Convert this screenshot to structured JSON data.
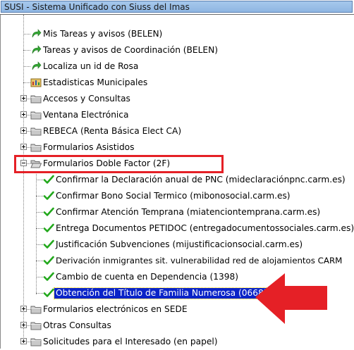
{
  "window": {
    "title": "SUSI - Sistema Unificado con Siuss del Imas"
  },
  "tree": {
    "root_items": [
      {
        "label": "Mis Tareas y avisos (BELEN)",
        "icon": "green-arrow-icon"
      },
      {
        "label": "Tareas y avisos de Coordinación (BELEN)",
        "icon": "green-arrow-icon"
      },
      {
        "label": "Localiza un id de Rosa",
        "icon": "green-arrow-icon"
      },
      {
        "label": "Estadisticas Municipales",
        "icon": "report-icon"
      },
      {
        "label": "Accesos y Consultas",
        "icon": "folder-icon"
      },
      {
        "label": "Ventana Electrónica",
        "icon": "folder-icon"
      },
      {
        "label": "REBECA (Renta Básica Elect CA)",
        "icon": "folder-icon"
      },
      {
        "label": "Formularios Asistidos",
        "icon": "folder-icon"
      },
      {
        "label": "Formularios Doble Factor (2F)",
        "icon": "open-folder-icon"
      }
    ],
    "children": [
      {
        "label": "Confirmar la Declaración anual de PNC (mideclaraciónpnc.carm.es)"
      },
      {
        "label": "Confirmar Bono Social Termico (mibonosocial.carm.es)"
      },
      {
        "label": "Confirmar Atención Temprana (miatenciontemprana.carm.es)"
      },
      {
        "label": "Entrega Documentos PETIDOC (entregadocumentossociales.carm.es)"
      },
      {
        "label": "Justificación Subvenciones (mijustificacionsocial.carm.es)"
      },
      {
        "label": "Derivación inmigrantes sit. vulnerabilidad red de alojamientos CARM"
      },
      {
        "label": "Cambio de cuenta en Dependencia (1398)"
      },
      {
        "label": "Obtención del Título de Familia Numerosa (0668)"
      }
    ],
    "after_items": [
      {
        "label": "Formularios electrónicos en SEDE",
        "icon": "folder-icon"
      },
      {
        "label": "Otras Consultas",
        "icon": "folder-icon"
      },
      {
        "label": "Solicitudes para el Interesado (en papel)",
        "icon": "folder-icon"
      }
    ],
    "selected": "Obtención del Título de Familia Numerosa (0668)"
  },
  "colors": {
    "selection_bg": "#0a24c8",
    "highlight_box": "#e52026",
    "arrow": "#e52026",
    "check": "#22a81c"
  }
}
